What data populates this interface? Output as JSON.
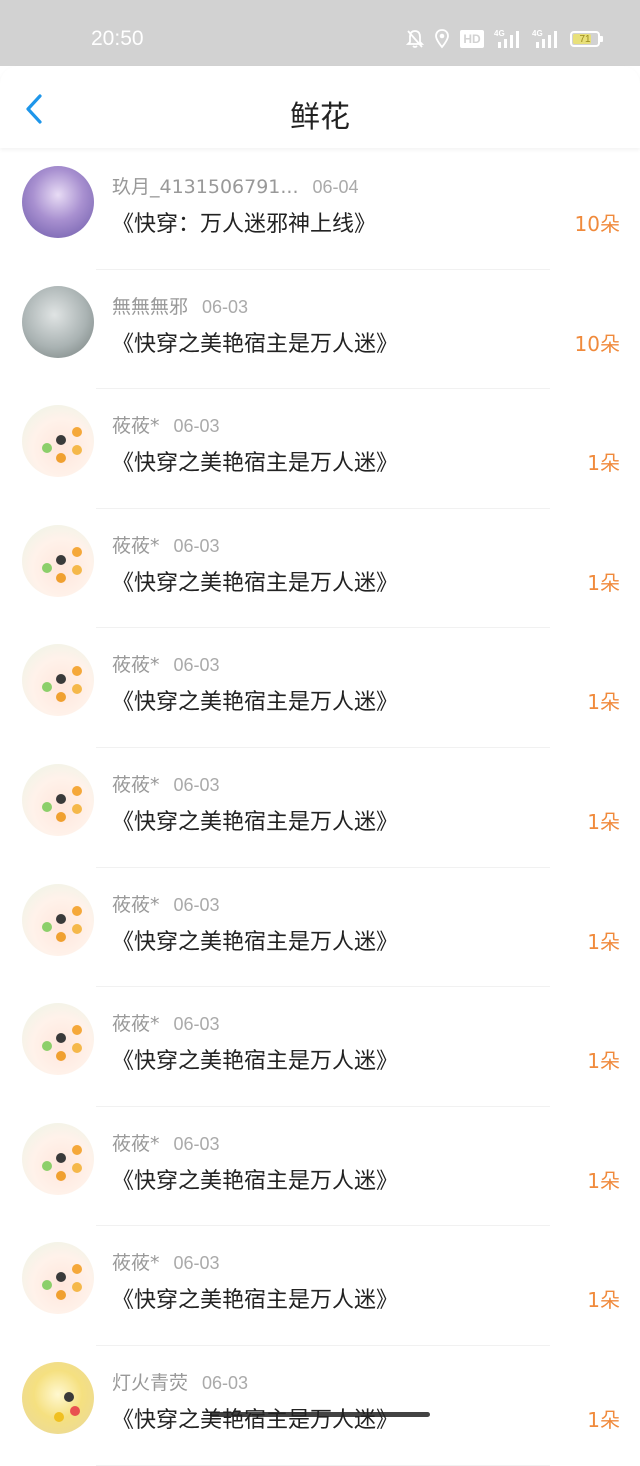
{
  "status_bar": {
    "time": "20:50",
    "icons": [
      "mute-bell-icon",
      "location-icon",
      "hd-icon",
      "signal-4g-icon",
      "signal-4g-icon",
      "battery-icon"
    ],
    "hd_label": "HD",
    "network_label": "4G",
    "battery_level": "71",
    "battery_fraction": 0.71,
    "battery_color": "#e8e07a"
  },
  "header": {
    "title": "鲜花",
    "back_icon": "chevron-left-icon",
    "accent_color": "#1e96ea"
  },
  "accent_count_color": "#f08a3c",
  "flower_list": [
    {
      "name": "玖月_4131506791...",
      "date": "06-04",
      "book": "《快穿：万人迷邪神上线》",
      "count": "10朵"
    },
    {
      "name": "無無無邪",
      "date": "06-03",
      "book": "《快穿之美艳宿主是万人迷》",
      "count": "10朵"
    },
    {
      "name": "莜莜*",
      "date": "06-03",
      "book": "《快穿之美艳宿主是万人迷》",
      "count": "1朵"
    },
    {
      "name": "莜莜*",
      "date": "06-03",
      "book": "《快穿之美艳宿主是万人迷》",
      "count": "1朵"
    },
    {
      "name": "莜莜*",
      "date": "06-03",
      "book": "《快穿之美艳宿主是万人迷》",
      "count": "1朵"
    },
    {
      "name": "莜莜*",
      "date": "06-03",
      "book": "《快穿之美艳宿主是万人迷》",
      "count": "1朵"
    },
    {
      "name": "莜莜*",
      "date": "06-03",
      "book": "《快穿之美艳宿主是万人迷》",
      "count": "1朵"
    },
    {
      "name": "莜莜*",
      "date": "06-03",
      "book": "《快穿之美艳宿主是万人迷》",
      "count": "1朵"
    },
    {
      "name": "莜莜*",
      "date": "06-03",
      "book": "《快穿之美艳宿主是万人迷》",
      "count": "1朵"
    },
    {
      "name": "莜莜*",
      "date": "06-03",
      "book": "《快穿之美艳宿主是万人迷》",
      "count": "1朵"
    },
    {
      "name": "灯火青荧",
      "date": "06-03",
      "book": "《快穿之美艳宿主是万人迷》",
      "count": "1朵"
    }
  ]
}
